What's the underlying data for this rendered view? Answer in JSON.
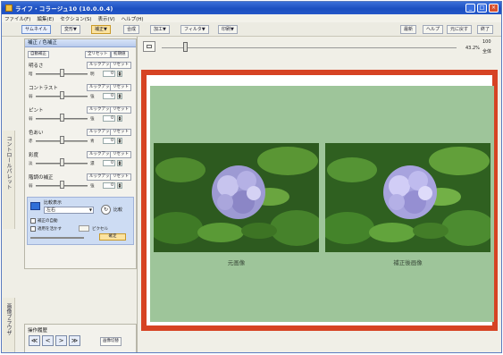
{
  "window": {
    "title": "ライフ・コラージュ10 (10.0.0.4)",
    "controls": [
      "_",
      "□",
      "×"
    ]
  },
  "menubar": [
    "ファイル(F)",
    "編集(E)",
    "セクション(S)",
    "表示(V)",
    "ヘルプ(H)"
  ],
  "toolbar": {
    "left_buttons": [
      "サムネイル",
      "変形▼",
      "補正▼",
      "合成",
      "加工▼",
      "フィルタ▼",
      "印刷▼"
    ],
    "right_buttons": [
      "最新",
      "ヘルプ",
      "元に戻す",
      "終了"
    ]
  },
  "side_tabs": {
    "control_palette": "コントロールパレット",
    "image_browser": "画像ブラウザ"
  },
  "panel": {
    "title": "補正 / 色補正",
    "auto_button": "自動補正",
    "reset_button": "全リセット",
    "initial_button": "初期値",
    "params": [
      {
        "label": "明るさ",
        "b1": "ルックアップ",
        "b2": "リセット",
        "min": "暗",
        "max": "明",
        "value": "0",
        "level": 0.5
      },
      {
        "label": "コントラスト",
        "b1": "ルックアップ",
        "b2": "リセット",
        "min": "弱",
        "max": "強",
        "value": "0",
        "level": 0.5
      },
      {
        "label": "ピント",
        "b1": "ルックアップ",
        "b2": "リセット",
        "min": "弱",
        "max": "強",
        "value": "0",
        "level": 0.5
      },
      {
        "label": "色あい",
        "b1": "ルックアップ",
        "b2": "リセット",
        "min": "赤",
        "max": "青",
        "value": "0",
        "level": 0.5
      },
      {
        "label": "彩度",
        "b1": "ルックアップ",
        "b2": "リセット",
        "min": "淡",
        "max": "濃",
        "value": "0",
        "level": 0.5
      },
      {
        "label": "階調の補正",
        "b1": "ルックアップ",
        "b2": "リセット",
        "min": "弱",
        "max": "強",
        "value": "0",
        "level": 0.5
      }
    ],
    "compare": {
      "label": "比較表示",
      "select_value": "左右",
      "compare_button": "比較",
      "option1": "補正の自動",
      "option2": "適用を活かす",
      "option_suffix": "ピクセル"
    },
    "apply_button": "確定"
  },
  "history": {
    "label": "操作履歴",
    "nav": [
      "≪",
      "<",
      ">",
      "≫"
    ],
    "image_button": "画像切替"
  },
  "zoom": {
    "value": "43.2%",
    "labels": [
      "100",
      "全体"
    ]
  },
  "preview": {
    "captions": [
      "元画像",
      "補正後画像"
    ],
    "frame_color": "#d64323",
    "background_color": "#9ec59a"
  }
}
